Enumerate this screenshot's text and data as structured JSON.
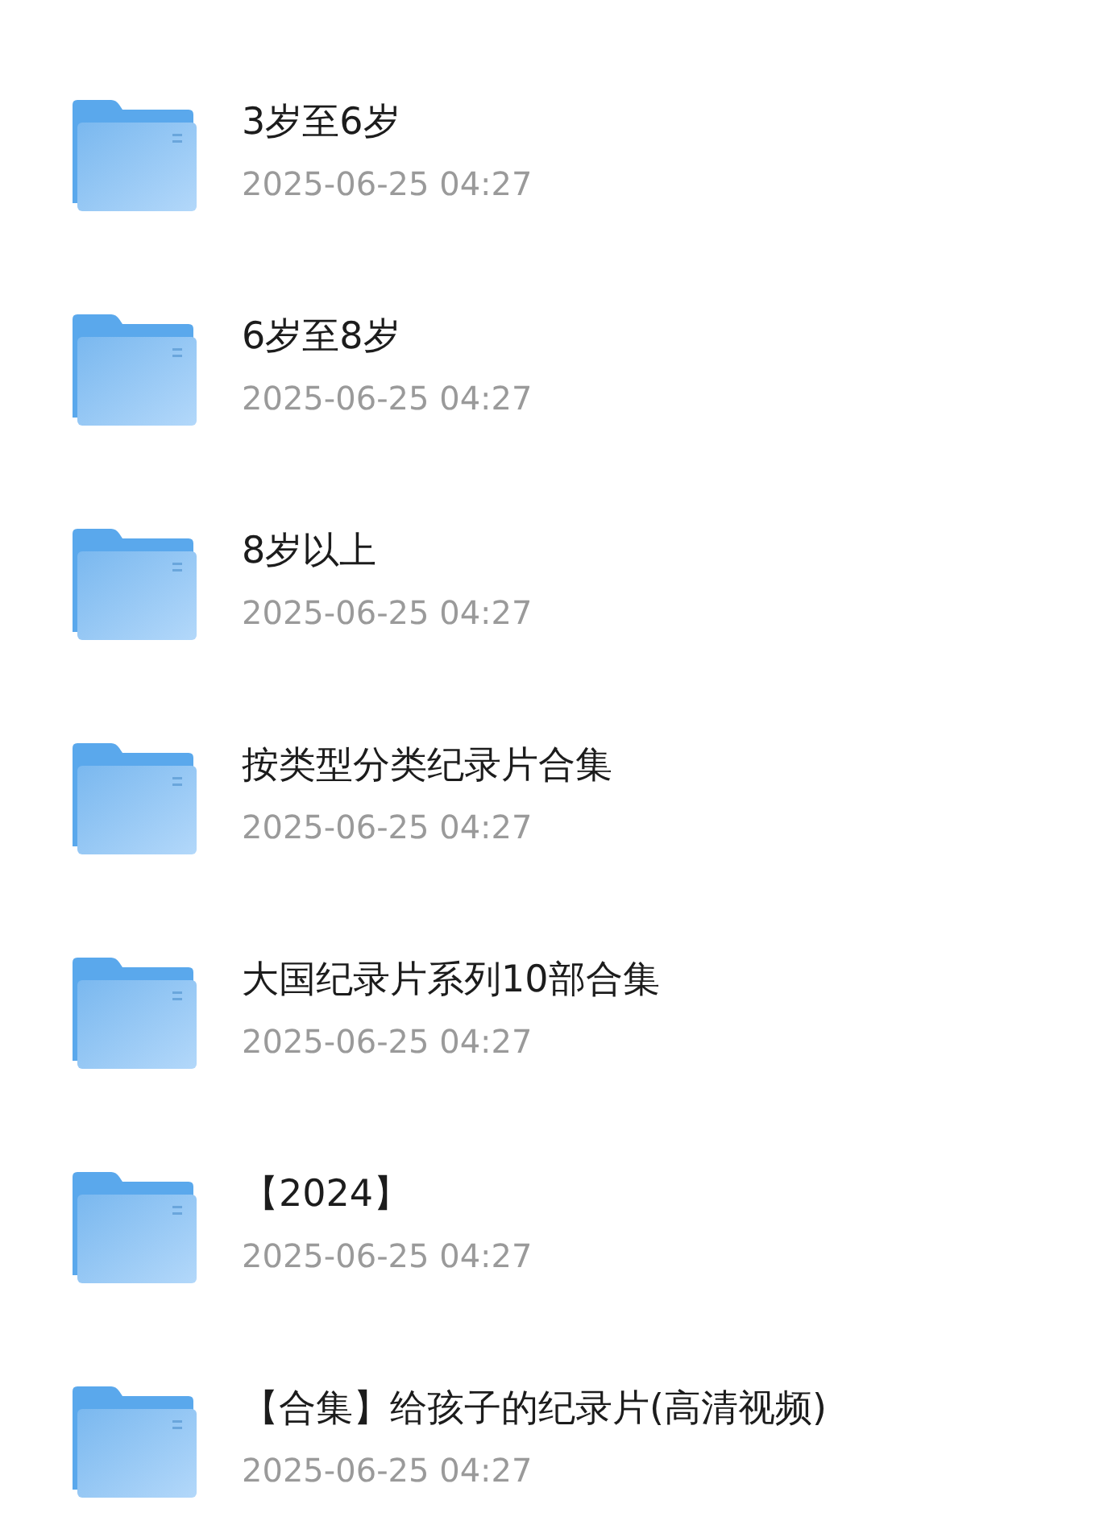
{
  "folders": [
    {
      "name": "3岁至6岁",
      "modified": "2025-06-25 04:27"
    },
    {
      "name": "6岁至8岁",
      "modified": "2025-06-25 04:27"
    },
    {
      "name": "8岁以上",
      "modified": "2025-06-25 04:27"
    },
    {
      "name": "按类型分类纪录片合集",
      "modified": "2025-06-25 04:27"
    },
    {
      "name": "大国纪录片系列10部合集",
      "modified": "2025-06-25 04:27"
    },
    {
      "name": "【2024】",
      "modified": "2025-06-25 04:27"
    },
    {
      "name": "【合集】给孩子的纪录片(高清视频)",
      "modified": "2025-06-25 04:27"
    }
  ]
}
